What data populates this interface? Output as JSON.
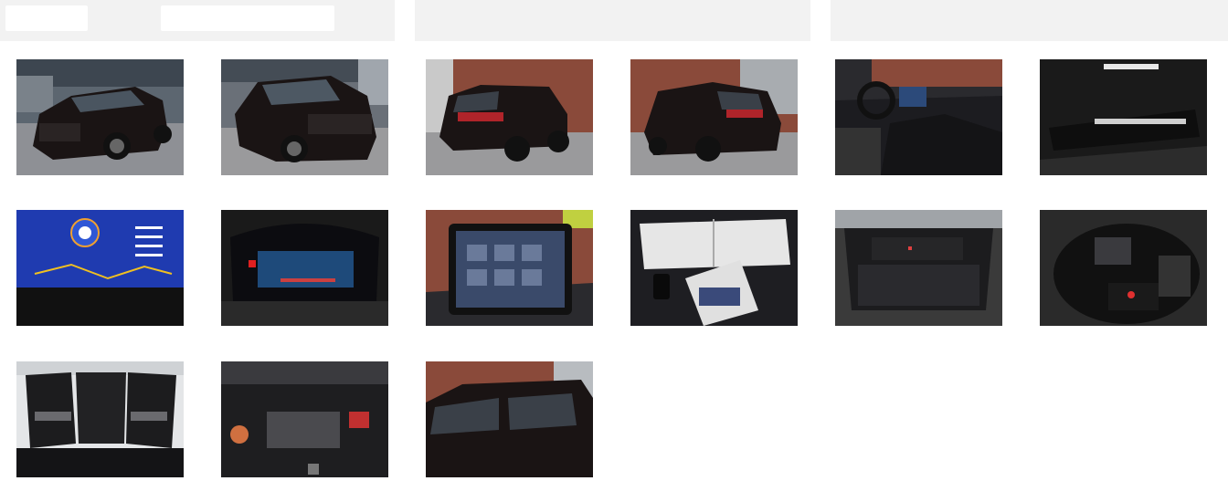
{
  "header": {
    "tabs": [
      "",
      "",
      ""
    ]
  },
  "gallery": {
    "photos": [
      {
        "icon": "car-front-left-photo"
      },
      {
        "icon": "car-front-right-photo"
      },
      {
        "icon": "car-rear-left-photo"
      },
      {
        "icon": "car-rear-right-photo"
      },
      {
        "icon": "dashboard-interior-photo"
      },
      {
        "icon": "sill-plate-photo"
      },
      {
        "icon": "instrument-cluster-photo"
      },
      {
        "icon": "digital-gauges-photo"
      },
      {
        "icon": "infotainment-screen-photo"
      },
      {
        "icon": "manuals-keys-photo"
      },
      {
        "icon": "trunk-photo"
      },
      {
        "icon": "spare-wheel-kit-photo"
      },
      {
        "icon": "rear-seats-photo"
      },
      {
        "icon": "engine-bay-photo"
      },
      {
        "icon": "roof-side-photo"
      }
    ]
  },
  "colors": {
    "header_bg": "#f2f2f2",
    "car_paint": "#1a1414",
    "brick": "#8a4a3a",
    "floor": "#8c8c8c"
  }
}
